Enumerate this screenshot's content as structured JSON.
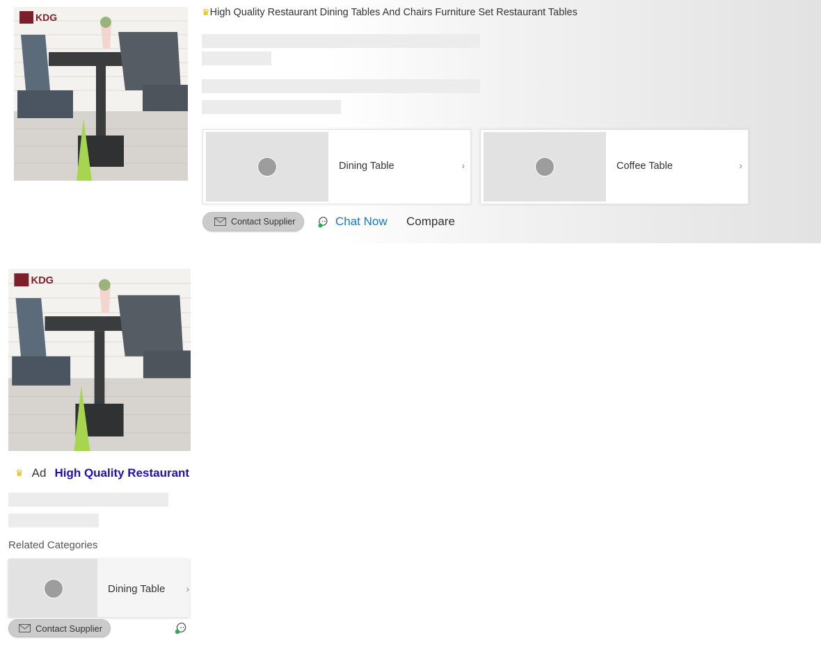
{
  "listing": {
    "title": "High Quality Restaurant Dining Tables And Chairs Furniture Set Restaurant Tables",
    "related_categories": [
      {
        "label": "Dining Table"
      },
      {
        "label": "Coffee Table"
      }
    ],
    "contact_label": "Contact Supplier",
    "chat_label": "Chat Now",
    "compare_label": "Compare"
  },
  "ad_listing": {
    "ad_badge": "Ad",
    "title": "High Quality Restaurant Dining Tables And Chairs Furniture Set Restaurant Tables",
    "related_heading": "Related Categories",
    "related_category": {
      "label": "Dining Table"
    },
    "contact_label": "Contact Supplier"
  },
  "colors": {
    "crown": "#e8b400",
    "chat_link": "#1677c8",
    "ad_title": "#1f0fb3",
    "online_dot": "#22b14c"
  },
  "icons": {
    "crown": "crown-icon",
    "envelope": "envelope-icon",
    "chat": "chat-bubble-icon",
    "chevron": "chevron-right-icon"
  }
}
